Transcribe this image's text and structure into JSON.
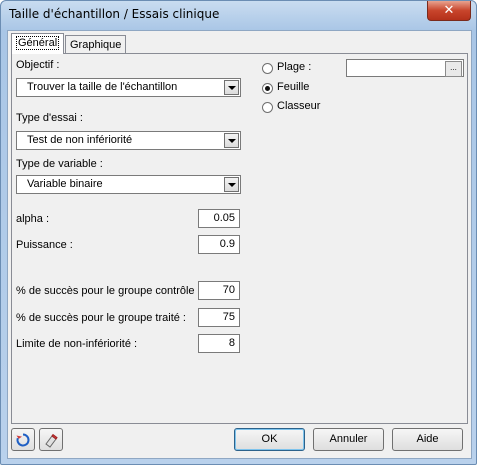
{
  "window": {
    "title": "Taille d'échantillon / Essais clinique",
    "close_label": "✕"
  },
  "tabs": [
    {
      "label": "Général"
    },
    {
      "label": "Graphique"
    }
  ],
  "general": {
    "objectif_label": "Objectif :",
    "objectif_value": "Trouver la taille de l'échantillon",
    "type_essai_label": "Type d'essai :",
    "type_essai_value": "Test de non infériorité",
    "type_variable_label": "Type de variable :",
    "type_variable_value": "Variable binaire",
    "alpha_label": "alpha :",
    "alpha_value": "0.05",
    "puissance_label": "Puissance :",
    "puissance_value": "0.9",
    "succes_controle_label": "% de succès pour le groupe contrôle :",
    "succes_controle_value": "70",
    "succes_traite_label": "% de succès pour le groupe traité :",
    "succes_traite_value": "75",
    "limite_label": "Limite de non-infériorité :",
    "limite_value": "8"
  },
  "output": {
    "plage_label": "Plage :",
    "feuille_label": "Feuille",
    "classeur_label": "Classeur",
    "selected": "Feuille",
    "range_button": "..."
  },
  "footer": {
    "ok": "OK",
    "annuler": "Annuler",
    "aide": "Aide"
  },
  "colors": {
    "accent": "#2c628b",
    "reset_icon": "#1f5fc4",
    "eraser_icon": "#d04040"
  }
}
